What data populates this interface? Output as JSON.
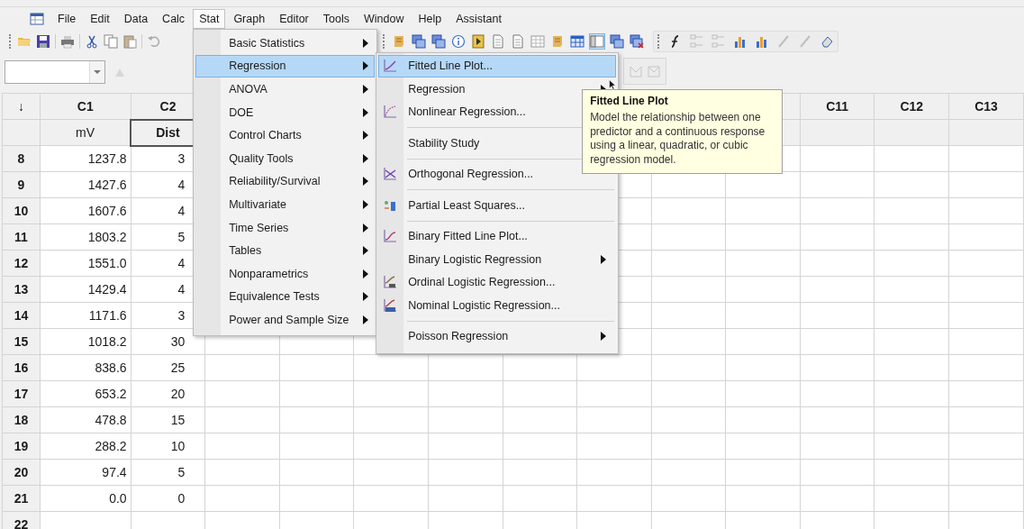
{
  "menubar": {
    "items": [
      {
        "label": "File",
        "selected": false
      },
      {
        "label": "Edit",
        "selected": false
      },
      {
        "label": "Data",
        "selected": false
      },
      {
        "label": "Calc",
        "selected": false
      },
      {
        "label": "Stat",
        "selected": true
      },
      {
        "label": "Graph",
        "selected": false
      },
      {
        "label": "Editor",
        "selected": false
      },
      {
        "label": "Tools",
        "selected": false
      },
      {
        "label": "Window",
        "selected": false
      },
      {
        "label": "Help",
        "selected": false
      },
      {
        "label": "Assistant",
        "selected": false
      }
    ]
  },
  "stat_menu": {
    "items": [
      {
        "label": "Basic Statistics",
        "submenu": true,
        "selected": false
      },
      {
        "label": "Regression",
        "submenu": true,
        "selected": true
      },
      {
        "label": "ANOVA",
        "submenu": true,
        "selected": false
      },
      {
        "label": "DOE",
        "submenu": true,
        "selected": false
      },
      {
        "label": "Control Charts",
        "submenu": true,
        "selected": false
      },
      {
        "label": "Quality Tools",
        "submenu": true,
        "selected": false
      },
      {
        "label": "Reliability/Survival",
        "submenu": true,
        "selected": false
      },
      {
        "label": "Multivariate",
        "submenu": true,
        "selected": false
      },
      {
        "label": "Time Series",
        "submenu": true,
        "selected": false
      },
      {
        "label": "Tables",
        "submenu": true,
        "selected": false
      },
      {
        "label": "Nonparametrics",
        "submenu": true,
        "selected": false
      },
      {
        "label": "Equivalence Tests",
        "submenu": true,
        "selected": false
      },
      {
        "label": "Power and Sample Size",
        "submenu": true,
        "selected": false
      }
    ]
  },
  "regression_menu": {
    "items": [
      {
        "label": "Fitted Line Plot...",
        "kind": "fitted",
        "submenu": false,
        "separator_before": false,
        "selected": true
      },
      {
        "label": "Regression",
        "kind": "plain",
        "submenu": true,
        "separator_before": false,
        "selected": false
      },
      {
        "label": "Nonlinear Regression...",
        "kind": "nonlinear",
        "submenu": false,
        "separator_before": false,
        "selected": false
      },
      {
        "label": "Stability Study",
        "kind": "plain",
        "submenu": false,
        "separator_before": true,
        "selected": false
      },
      {
        "label": "Orthogonal Regression...",
        "kind": "orthogonal",
        "submenu": false,
        "separator_before": true,
        "selected": false
      },
      {
        "label": "Partial Least Squares...",
        "kind": "pls",
        "submenu": false,
        "separator_before": true,
        "selected": false
      },
      {
        "label": "Binary Fitted Line Plot...",
        "kind": "binary",
        "submenu": false,
        "separator_before": true,
        "selected": false
      },
      {
        "label": "Binary Logistic Regression",
        "kind": "plain",
        "submenu": true,
        "separator_before": false,
        "selected": false
      },
      {
        "label": "Ordinal Logistic Regression...",
        "kind": "ordinal",
        "submenu": false,
        "separator_before": false,
        "selected": false
      },
      {
        "label": "Nominal Logistic Regression...",
        "kind": "nominal",
        "submenu": false,
        "separator_before": false,
        "selected": false
      },
      {
        "label": "Poisson Regression",
        "kind": "plain",
        "submenu": true,
        "separator_before": true,
        "selected": false
      }
    ]
  },
  "tooltip": {
    "title": "Fitted Line Plot",
    "text": "Model the relationship between one predictor and a continuous response using a linear, quadratic, or cubic regression model."
  },
  "worksheet": {
    "corner": "↓",
    "columns": [
      {
        "label": "C1",
        "name": "mV",
        "selected": false
      },
      {
        "label": "C2",
        "name": "Dist",
        "selected": true
      },
      {
        "label": "C11",
        "selected": false
      },
      {
        "label": "C12",
        "selected": false
      },
      {
        "label": "C13",
        "selected": false
      }
    ],
    "rows": [
      {
        "row": "8",
        "values": [
          "1237.8",
          "3"
        ]
      },
      {
        "row": "9",
        "values": [
          "1427.6",
          "4"
        ]
      },
      {
        "row": "10",
        "values": [
          "1607.6",
          "4"
        ]
      },
      {
        "row": "11",
        "values": [
          "1803.2",
          "5"
        ]
      },
      {
        "row": "12",
        "values": [
          "1551.0",
          "4"
        ]
      },
      {
        "row": "13",
        "values": [
          "1429.4",
          "4"
        ]
      },
      {
        "row": "14",
        "values": [
          "1171.6",
          "3"
        ]
      },
      {
        "row": "15",
        "values": [
          "1018.2",
          "30"
        ]
      },
      {
        "row": "16",
        "values": [
          "838.6",
          "25"
        ]
      },
      {
        "row": "17",
        "values": [
          "653.2",
          "20"
        ]
      },
      {
        "row": "18",
        "values": [
          "478.8",
          "15"
        ]
      },
      {
        "row": "19",
        "values": [
          "288.2",
          "10"
        ]
      },
      {
        "row": "20",
        "values": [
          "97.4",
          "5"
        ]
      },
      {
        "row": "21",
        "values": [
          "0.0",
          "0"
        ]
      },
      {
        "row": "22"
      }
    ]
  }
}
